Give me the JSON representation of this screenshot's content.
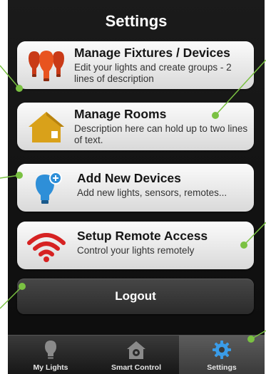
{
  "screen": {
    "title": "Settings"
  },
  "menu": [
    {
      "title": "Manage Fixtures / Devices",
      "description": "Edit your lights and create groups - 2 lines of description",
      "icon": "bulbs-icon",
      "color": "#d9461c"
    },
    {
      "title": "Manage Rooms",
      "description": "Description here can hold up to two lines of text.",
      "icon": "house-icon",
      "color": "#d9a11a"
    },
    {
      "title": "Add New Devices",
      "description": "Add new lights, sensors, remotes...",
      "icon": "bulb-plus-icon",
      "color": "#2e8fd8"
    },
    {
      "title": "Setup Remote Access",
      "description": "Control your lights remotely",
      "icon": "wifi-icon",
      "color": "#d62222"
    }
  ],
  "logout": {
    "label": "Logout"
  },
  "tabs": [
    {
      "label": "My Lights",
      "icon": "lightbulb-icon",
      "selected": false
    },
    {
      "label": "Smart Control",
      "icon": "house-gear-icon",
      "selected": false
    },
    {
      "label": "Settings",
      "icon": "gear-icon",
      "selected": true
    }
  ],
  "colors": {
    "annotation": "#7ac142",
    "background": "#111111",
    "selected_tab_icon": "#3a9ce8"
  }
}
